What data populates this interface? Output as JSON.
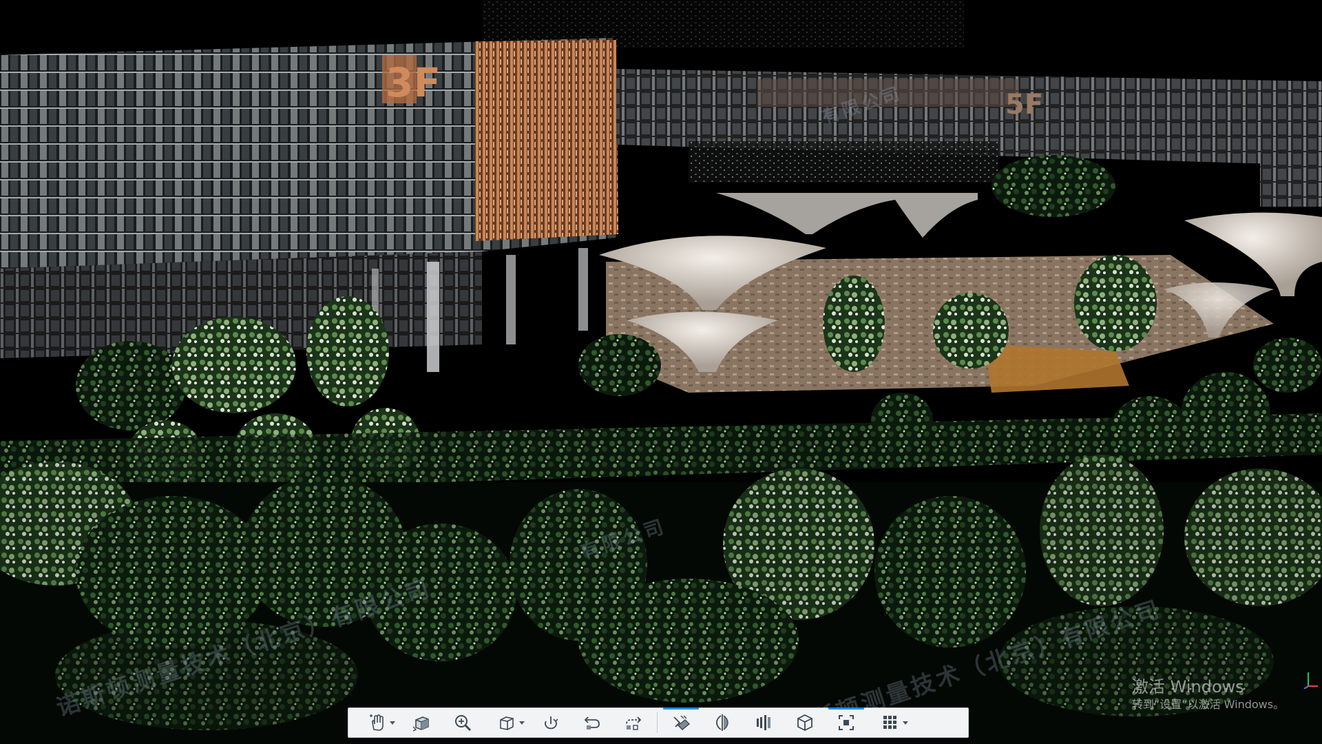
{
  "viewer": {
    "scene": "point-cloud",
    "background_color": "#000000"
  },
  "watermark": {
    "text": "诺斯顿测量技术（北京）有限公司",
    "partial_text": "有限公司"
  },
  "windows_activation": {
    "title": "激活 Windows",
    "subtitle": "转到“设置”以激活 Windows。"
  },
  "building": {
    "sign_left": "3F",
    "sign_right": "5F"
  },
  "toolbar": {
    "accent_color": "#1e90ff",
    "buttons": [
      {
        "name": "pan-tool-icon",
        "has_dropdown": true,
        "active": false
      },
      {
        "name": "view-cube-icon",
        "has_dropdown": false,
        "active": false
      },
      {
        "name": "zoom-icon",
        "has_dropdown": false,
        "active": false
      },
      {
        "name": "box-view-icon",
        "has_dropdown": true,
        "active": false
      },
      {
        "name": "rotate-icon",
        "has_dropdown": false,
        "active": false
      },
      {
        "name": "undo-view-icon",
        "has_dropdown": false,
        "active": false
      },
      {
        "name": "redo-view-icon",
        "has_dropdown": false,
        "active": false
      },
      {
        "name": "measure-tool-icon",
        "has_dropdown": false,
        "active": true
      },
      {
        "name": "clip-plane-icon",
        "has_dropdown": false,
        "active": false
      },
      {
        "name": "section-slice-icon",
        "has_dropdown": false,
        "active": false
      },
      {
        "name": "3d-box-icon",
        "has_dropdown": false,
        "active": false
      },
      {
        "name": "fit-extents-icon",
        "has_dropdown": false,
        "active": true
      },
      {
        "name": "grid-menu-icon",
        "has_dropdown": true,
        "active": false
      }
    ]
  }
}
